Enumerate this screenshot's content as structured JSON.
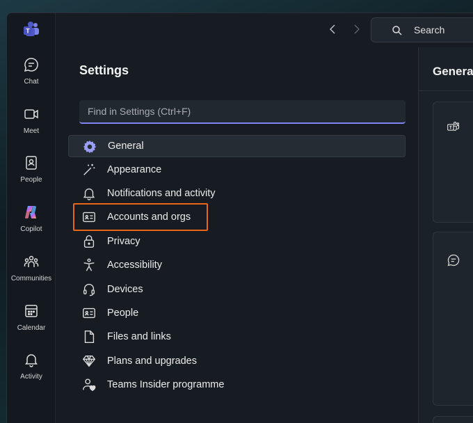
{
  "topbar": {
    "search_label": "Search"
  },
  "rail": {
    "items": [
      {
        "label": "Chat",
        "icon": "chat-icon"
      },
      {
        "label": "Meet",
        "icon": "video-icon"
      },
      {
        "label": "People",
        "icon": "contact-card-icon"
      },
      {
        "label": "Copilot",
        "icon": "copilot-icon"
      },
      {
        "label": "Communities",
        "icon": "communities-icon"
      },
      {
        "label": "Calendar",
        "icon": "calendar-icon"
      },
      {
        "label": "Activity",
        "icon": "bell-icon"
      }
    ]
  },
  "settings": {
    "title": "Settings",
    "search_placeholder": "Find in Settings (Ctrl+F)",
    "menu": [
      {
        "label": "General",
        "icon": "gear-icon",
        "active": true
      },
      {
        "label": "Appearance",
        "icon": "magic-wand-icon"
      },
      {
        "label": "Notifications and activity",
        "icon": "bell-icon"
      },
      {
        "label": "Accounts and orgs",
        "icon": "id-card-icon",
        "highlighted": true
      },
      {
        "label": "Privacy",
        "icon": "lock-icon"
      },
      {
        "label": "Accessibility",
        "icon": "accessibility-icon"
      },
      {
        "label": "Devices",
        "icon": "headset-icon"
      },
      {
        "label": "People",
        "icon": "contact-card-icon"
      },
      {
        "label": "Files and links",
        "icon": "document-icon"
      },
      {
        "label": "Plans and upgrades",
        "icon": "diamond-icon"
      },
      {
        "label": "Teams Insider programme",
        "icon": "person-heart-icon"
      }
    ]
  },
  "right_pane": {
    "header": "General"
  },
  "colors": {
    "accent": "#7f85f5",
    "highlight": "#e8661a",
    "background": "#171c22"
  }
}
